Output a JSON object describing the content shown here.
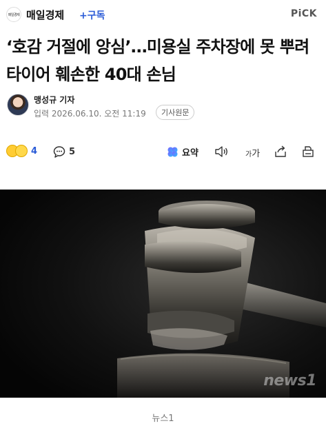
{
  "header": {
    "press_logo_text": "매일경제",
    "press_name": "매일경제",
    "subscribe_label": "+구독",
    "pick_label": "PiCK"
  },
  "article": {
    "headline": "‘호감 거절에 앙심’…미용실 주차장에 못 뿌려 타이어 훼손한 40대 손님",
    "author": "맹성규 기자",
    "date_line": "입력 2026.06.10. 오전 11:19",
    "original_label": "기사원문"
  },
  "actions": {
    "reaction_count": "4",
    "comment_count": "5",
    "summary_label": "요약",
    "font_size_label_small": "가",
    "font_size_label_large": "가"
  },
  "photo": {
    "watermark": "news1",
    "caption": "뉴스1"
  },
  "colors": {
    "accent_blue": "#2a5bd7",
    "text_dark": "#111111",
    "text_gray": "#777777"
  }
}
